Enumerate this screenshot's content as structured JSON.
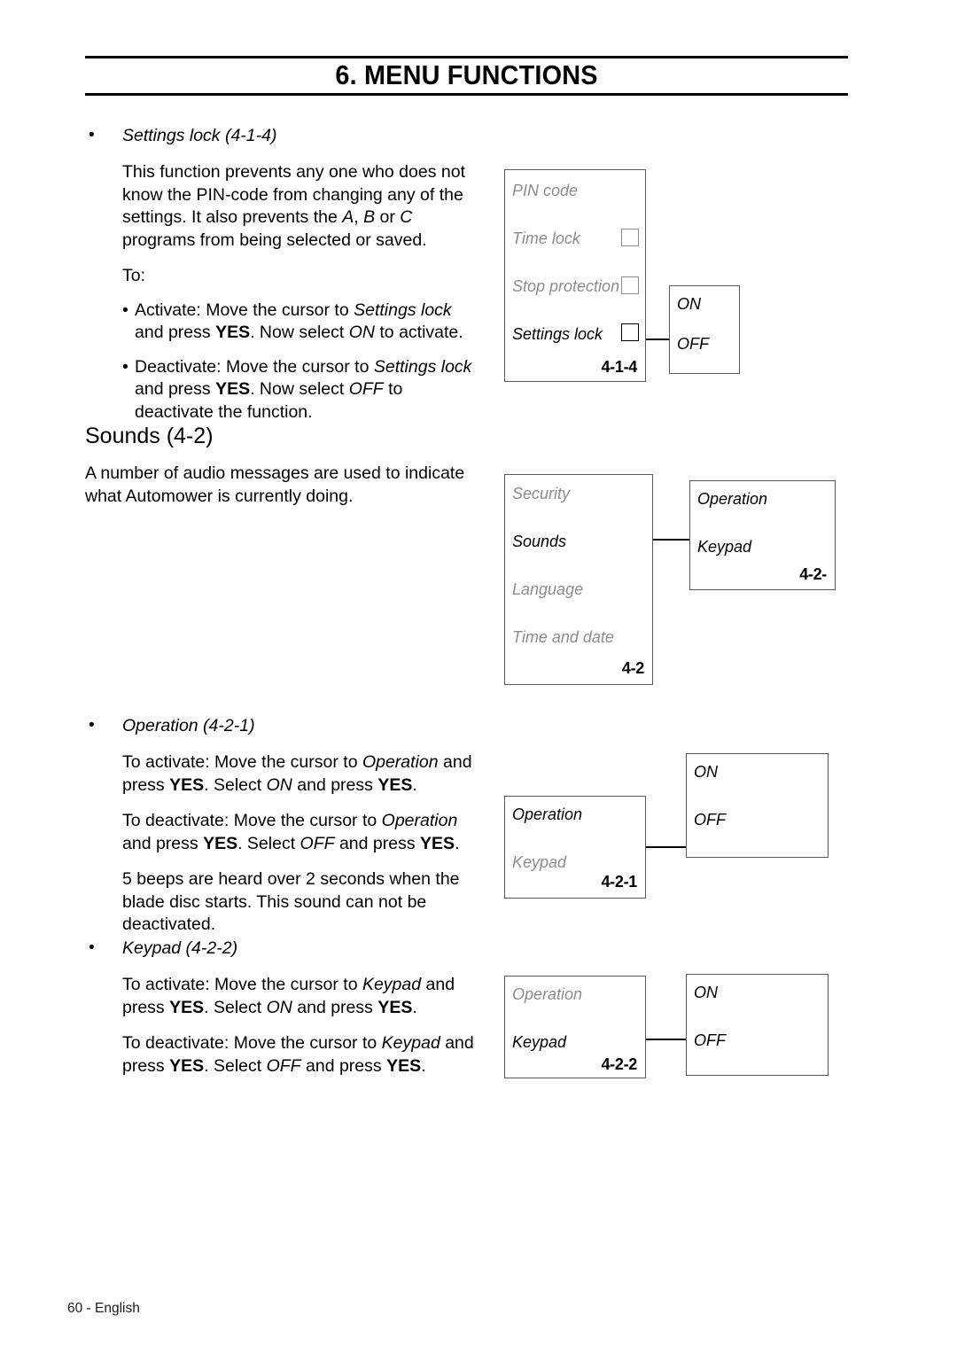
{
  "header": {
    "title": "6. MENU FUNCTIONS"
  },
  "footer": {
    "page_label": "60 - English"
  },
  "sections": {
    "settings_lock": {
      "heading": "Settings lock (4-1-4)",
      "bullet_glyph": "•",
      "paragraph": "This function prevents any one who does not know the PIN-code from changing any of the settings. It also prevents the A, B or C programs from being selected or saved.",
      "to_label": "To:",
      "items": [
        "Activate: Move the cursor to Settings lock and press YES. Now select ON to activate.",
        "Deactivate: Move the cursor to Settings lock and press YES. Now select OFF to deactivate the function."
      ]
    },
    "sounds": {
      "heading": "Sounds (4-2)",
      "paragraph": "A number of audio messages are used to indicate what Automower is currently doing."
    },
    "operation": {
      "heading": "Operation (4-2-1)",
      "paragraphs": [
        "To activate: Move the cursor to Operation and press YES. Select ON and press YES.",
        "To deactivate: Move the cursor to Operation and press YES. Select OFF and press YES.",
        "5 beeps are heard over 2 seconds when the blade disc starts. This sound can not be deactivated."
      ]
    },
    "keypad": {
      "heading": "Keypad (4-2-2)",
      "paragraphs": [
        "To activate: Move the cursor to Keypad and press YES. Select ON and press YES.",
        "To deactivate: Move the cursor to Keypad and press YES. Select OFF and press YES."
      ]
    }
  },
  "diagrams": {
    "settings_lock": {
      "menu_box": {
        "rows": [
          {
            "label": "PIN code",
            "state": "inactive",
            "checkbox": "none"
          },
          {
            "label": "Time lock",
            "state": "inactive",
            "checkbox": "inactive"
          },
          {
            "label": "Stop protection",
            "state": "inactive",
            "checkbox": "inactive"
          },
          {
            "label": "Settings lock",
            "state": "active",
            "checkbox": "active"
          }
        ],
        "code": "4-1-4"
      },
      "value_box": {
        "options": [
          "ON",
          "OFF"
        ]
      }
    },
    "sounds": {
      "menu_box": {
        "rows": [
          {
            "label": "Security",
            "state": "inactive"
          },
          {
            "label": "Sounds",
            "state": "active"
          },
          {
            "label": "Language",
            "state": "inactive"
          },
          {
            "label": "Time and date",
            "state": "inactive"
          }
        ],
        "code": "4-2"
      },
      "submenu_box": {
        "rows": [
          {
            "label": "Operation",
            "state": "active"
          },
          {
            "label": "Keypad",
            "state": "active"
          }
        ],
        "code": "4-2-"
      }
    },
    "operation": {
      "menu_box": {
        "rows": [
          {
            "label": "Operation",
            "state": "active"
          },
          {
            "label": "Keypad",
            "state": "inactive"
          }
        ],
        "code": "4-2-1"
      },
      "value_box": {
        "options": [
          "ON",
          "OFF"
        ]
      }
    },
    "keypad": {
      "menu_box": {
        "rows": [
          {
            "label": "Operation",
            "state": "inactive"
          },
          {
            "label": "Keypad",
            "state": "active"
          }
        ],
        "code": "4-2-2"
      },
      "value_box": {
        "options": [
          "ON",
          "OFF"
        ]
      }
    }
  }
}
